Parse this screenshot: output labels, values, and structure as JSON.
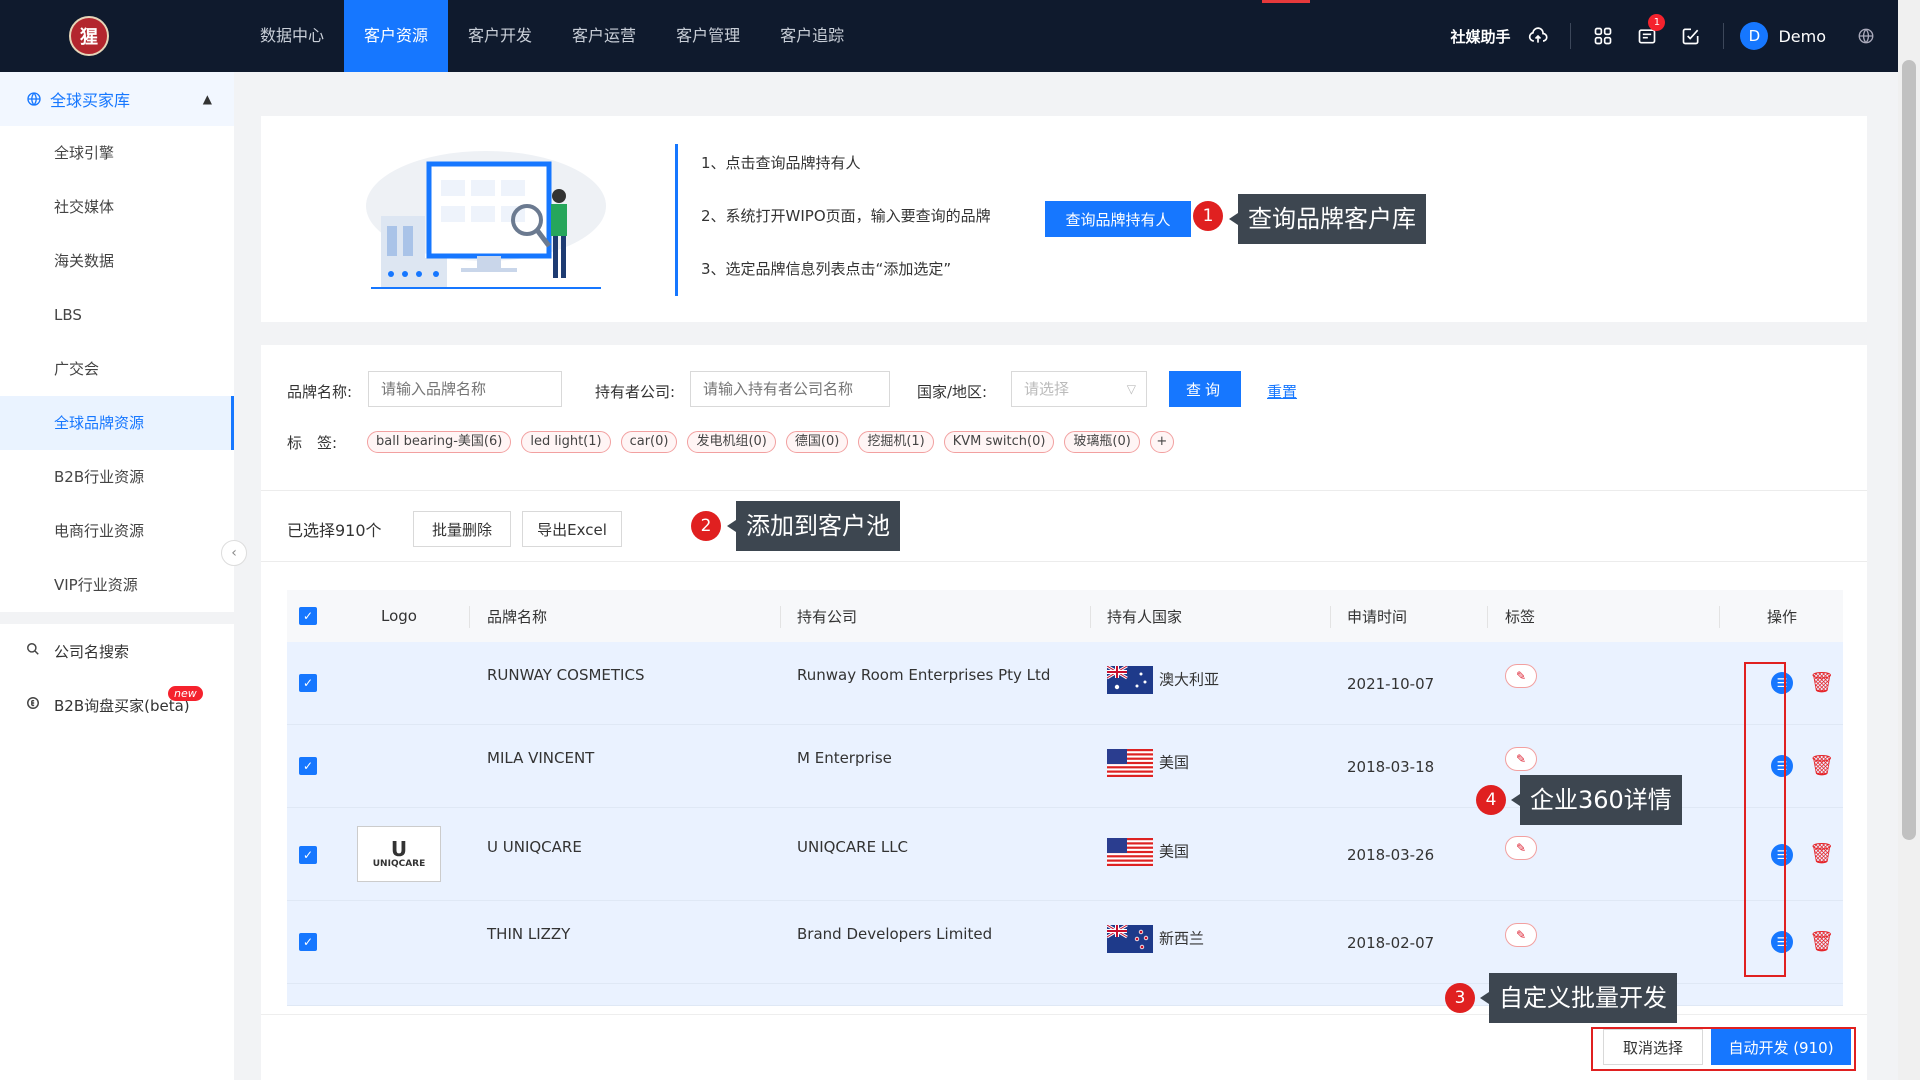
{
  "topnav": {
    "items": [
      "数据中心",
      "客户资源",
      "客户开发",
      "客户运营",
      "客户管理",
      "客户追踪"
    ],
    "active_index": 1,
    "logo_text": "猩",
    "social_label": "社媒助手",
    "message_badge": "1",
    "avatar_letter": "D",
    "user_name": "Demo",
    "icons": [
      "cloud-upload-icon",
      "apps-grid-icon",
      "message-icon",
      "edit-check-icon",
      "globe-icon"
    ]
  },
  "sidebar": {
    "group_label": "全球买家库",
    "items": [
      "全球引擎",
      "社交媒体",
      "海关数据",
      "LBS",
      "广交会",
      "全球品牌资源",
      "B2B行业资源",
      "电商行业资源",
      "VIP行业资源"
    ],
    "active_index": 5,
    "extra": [
      {
        "label": "公司名搜索",
        "icon": "search-icon"
      },
      {
        "label": "B2B询盘买家(beta)",
        "icon": "inquiry-icon",
        "badge": "new"
      }
    ]
  },
  "guide": {
    "steps": [
      "1、点击查询品牌持有人",
      "2、系统打开WIPO页面，输入要查询的品牌",
      "3、选定品牌信息列表点击“添加选定”"
    ],
    "button_label": "查询品牌持有人"
  },
  "callouts": {
    "c1": {
      "num": "1",
      "text": "查询品牌客户库"
    },
    "c2": {
      "num": "2",
      "text": "添加到客户池"
    },
    "c3": {
      "num": "3",
      "text": "自定义批量开发"
    },
    "c4": {
      "num": "4",
      "text": "企业360详情"
    }
  },
  "filter": {
    "brand_label": "品牌名称:",
    "brand_placeholder": "请输入品牌名称",
    "holder_label": "持有者公司:",
    "holder_placeholder": "请输入持有者公司名称",
    "country_label": "国家/地区:",
    "country_placeholder": "请选择",
    "query_button": "查询",
    "reset_link": "重置",
    "tags_label": "标　签:",
    "tags": [
      "ball bearing-美国(6)",
      "led light(1)",
      "car(0)",
      "发电机组(0)",
      "德国(0)",
      "挖掘机(1)",
      "KVM switch(0)",
      "玻璃瓶(0)",
      "+"
    ]
  },
  "selection": {
    "count_text": "已选择910个",
    "batch_delete": "批量删除",
    "export_excel": "导出Excel"
  },
  "table": {
    "headers": [
      "Logo",
      "品牌名称",
      "持有公司",
      "持有人国家",
      "申请时间",
      "标签",
      "操作"
    ],
    "rows": [
      {
        "brand": "RUNWAY COSMETICS",
        "company": "Runway Room Enterprises Pty Ltd",
        "country": "澳大利亚",
        "flag": "au",
        "date": "2021-10-07",
        "logo": ""
      },
      {
        "brand": "MILA VINCENT",
        "company": "M Enterprise",
        "country": "美国",
        "flag": "us",
        "date": "2018-03-18",
        "logo": ""
      },
      {
        "brand": "U UNIQCARE",
        "company": "UNIQCARE LLC",
        "country": "美国",
        "flag": "us",
        "date": "2018-03-26",
        "logo": "UNIQCARE"
      },
      {
        "brand": "THIN LIZZY",
        "company": "Brand Developers Limited",
        "country": "新西兰",
        "flag": "nz",
        "date": "2018-02-07",
        "logo": ""
      }
    ]
  },
  "footer": {
    "cancel_label": "取消选择",
    "auto_label": "自动开发 (910)"
  },
  "colors": {
    "primary": "#1677ff",
    "topbar": "#0f1a2d",
    "danger": "#e02020",
    "callout": "#3d4650"
  }
}
